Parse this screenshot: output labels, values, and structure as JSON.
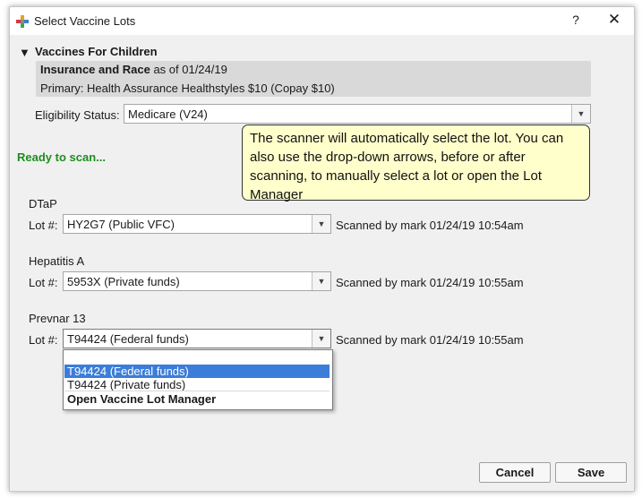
{
  "window": {
    "title": "Select Vaccine Lots",
    "help_label": "?",
    "close_label": "✕"
  },
  "section": {
    "arrow": "▼",
    "title": "Vaccines For Children"
  },
  "insurance": {
    "heading": "Insurance and Race",
    "asof": " as of 01/24/19",
    "primary": "Primary:  Health Assurance Healthstyles $10 (Copay $10)"
  },
  "eligibility": {
    "label": "Eligibility Status:",
    "value": "Medicare (V24)"
  },
  "status": {
    "ready": "Ready to scan...",
    "ready_color": "#1f8c1f"
  },
  "tooltip": {
    "text": "The scanner will automatically select the lot. You can also use the drop-down arrows, before or after scanning, to manually select a lot or open the Lot Manager",
    "background": "#ffffcc"
  },
  "vaccines": [
    {
      "name": "DTaP",
      "lot_label": "Lot #:",
      "lot_value": "HY2G7 (Public VFC)",
      "scanned": "Scanned by mark 01/24/19 10:54am"
    },
    {
      "name": "Hepatitis A",
      "lot_label": "Lot #:",
      "lot_value": "5953X (Private funds)",
      "scanned": "Scanned by mark 01/24/19 10:55am"
    },
    {
      "name": "Prevnar 13",
      "lot_label": "Lot #:",
      "lot_value": "T94424 (Federal funds)",
      "scanned": "Scanned by mark 01/24/19 10:55am"
    }
  ],
  "dropdown": {
    "options": [
      {
        "label": "T94424 (Federal funds)",
        "selected": true
      },
      {
        "label": "T94424 (Private funds)",
        "selected": false
      },
      {
        "label": "Open Vaccine Lot Manager",
        "selected": false
      }
    ],
    "highlight_color": "#3b7dd8"
  },
  "buttons": {
    "cancel": "Cancel",
    "save": "Save"
  },
  "icons": {
    "app": "colored-cross-icon",
    "dropdown_arrow": "chevron-down-icon"
  }
}
